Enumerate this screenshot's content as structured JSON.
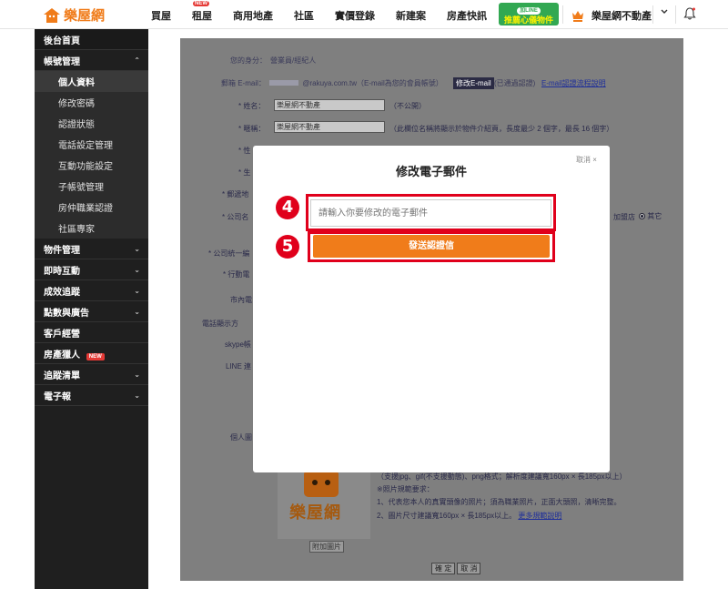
{
  "brand": {
    "name": "樂屋網",
    "color": "#f07c1a"
  },
  "nav": {
    "items": [
      "買屋",
      "租屋",
      "商用地產",
      "社區",
      "實價登錄",
      "新建案",
      "房產快訊"
    ],
    "new_tag": "NEW"
  },
  "line_banner": {
    "pill": "加LINE",
    "text": "推薦心儀物件"
  },
  "user": {
    "name": "樂屋網不動產"
  },
  "sidebar": {
    "home": "後台首頁",
    "account": {
      "label": "帳號管理",
      "subs": [
        "個人資料",
        "修改密碼",
        "認證狀態",
        "電話設定管理",
        "互動功能設定",
        "子帳號管理",
        "房仲職業認證",
        "社區專家"
      ]
    },
    "groups": [
      "物件管理",
      "即時互動",
      "成效追蹤",
      "點數與廣告",
      "客戶經營",
      "房產獵人",
      "追蹤清單",
      "電子報"
    ],
    "hunter_badge": "NEW"
  },
  "form": {
    "identity": "您的身分：　營業員/經紀人",
    "email_label": "郵箱 E-mail：",
    "email_value": "@rakuya.com.tw（E-mail為您的會員帳號）",
    "modify_email": "修改E-mail",
    "verified": "(已通過認證)",
    "email_help": "E-mail認證流程說明",
    "name_label": "* 姓名：",
    "name_value": "樂屋網不動產",
    "name_note": "（不公開）",
    "nick_label": "* 暱稱：",
    "nick_value": "樂屋網不動產",
    "nick_note": "（此欄位名稱將顯示於物件介紹頁，長度最少 2 個字，最長 16 個字）",
    "gender_label": "* 性",
    "birth_label": "* 生",
    "address_label": "* 郵遞地",
    "company_label": "* 公司名",
    "store_opt": "加盟店",
    "other_opt": "其它",
    "tax_label": "* 公司統一編",
    "mobile_label": "* 行動電",
    "city_label": "市內電",
    "display_label": "電話顯示方",
    "skype_label": "skype帳",
    "line_label": "LINE 連",
    "avatar_label": "個人圖",
    "photo_note1": "（支援jpg、gif(不支援動態)、png格式；解析度建議寬160px × 長185px以上）",
    "photo_note2": "※照片規範要求：",
    "photo_note3": "1、代表您本人的真實頭像的照片；須為職業照片，正面大頭照，清晰完整。",
    "photo_note4": "2、圖片尺寸建議寬160px × 長185px以上。",
    "photo_link": "更多規範說明",
    "upload": "附加圖片",
    "confirm": "確 定",
    "cancel": "取 消"
  },
  "modal": {
    "title": "修改電子郵件",
    "close": "取消 ×",
    "placeholder": "請輸入你要修改的電子郵件",
    "send": "發送認證信",
    "step4": "4",
    "step5": "5"
  }
}
